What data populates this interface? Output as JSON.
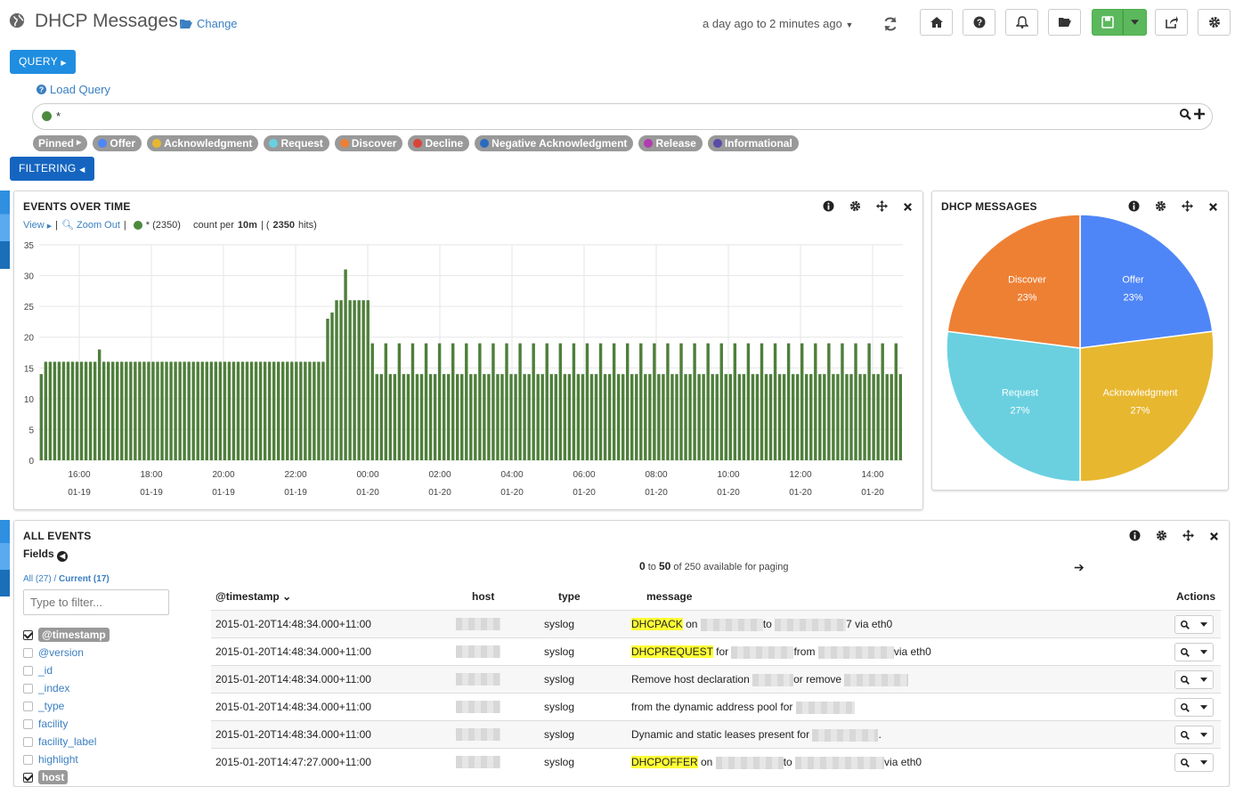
{
  "header": {
    "title": "DHCP Messages",
    "change_label": "Change",
    "time_range": "a day ago to 2 minutes ago"
  },
  "toolbar": {
    "icons": [
      "home-icon",
      "question-icon",
      "bell-icon",
      "folder-open-icon",
      "save-icon",
      "caret-down-icon",
      "share-icon",
      "gear-icon"
    ]
  },
  "query": {
    "query_btn": "QUERY",
    "load_query": "Load Query",
    "value": "*",
    "filter_btn": "FILTERING"
  },
  "pins": {
    "pinned": "Pinned",
    "items": [
      {
        "label": "Offer",
        "color": "#4f86f7"
      },
      {
        "label": "Acknowledgment",
        "color": "#e8b730"
      },
      {
        "label": "Request",
        "color": "#6ad0e0"
      },
      {
        "label": "Discover",
        "color": "#ee8034"
      },
      {
        "label": "Decline",
        "color": "#d9443a"
      },
      {
        "label": "Negative Acknowledgment",
        "color": "#2a6bbf"
      },
      {
        "label": "Release",
        "color": "#b23bb0"
      },
      {
        "label": "Informational",
        "color": "#5b4aa8"
      }
    ]
  },
  "events_panel": {
    "title": "EVENTS OVER TIME",
    "view": "View",
    "zoom_out": "Zoom Out",
    "series_label": "* (2350)",
    "count_per": "count per",
    "interval": "10m",
    "hits": "2350",
    "hits_suffix": "hits)"
  },
  "dhcp_panel": {
    "title": "DHCP MESSAGES"
  },
  "chart_data": [
    {
      "type": "bar",
      "title": "EVENTS OVER TIME",
      "ylim": [
        0,
        35
      ],
      "yticks": [
        0,
        5,
        10,
        15,
        20,
        25,
        30,
        35
      ],
      "xticks": [
        {
          "time": "16:00",
          "date": "01-19"
        },
        {
          "time": "18:00",
          "date": "01-19"
        },
        {
          "time": "20:00",
          "date": "01-19"
        },
        {
          "time": "22:00",
          "date": "01-19"
        },
        {
          "time": "00:00",
          "date": "01-20"
        },
        {
          "time": "02:00",
          "date": "01-20"
        },
        {
          "time": "04:00",
          "date": "01-20"
        },
        {
          "time": "06:00",
          "date": "01-20"
        },
        {
          "time": "08:00",
          "date": "01-20"
        },
        {
          "time": "10:00",
          "date": "01-20"
        },
        {
          "time": "12:00",
          "date": "01-20"
        },
        {
          "time": "14:00",
          "date": "01-20"
        }
      ],
      "values": [
        14,
        16,
        16,
        16,
        16,
        16,
        16,
        16,
        16,
        16,
        16,
        16,
        16,
        18,
        16,
        16,
        16,
        16,
        16,
        16,
        16,
        16,
        16,
        16,
        16,
        16,
        16,
        16,
        16,
        16,
        16,
        16,
        16,
        16,
        16,
        16,
        16,
        16,
        16,
        16,
        16,
        16,
        16,
        16,
        16,
        16,
        16,
        16,
        16,
        16,
        16,
        16,
        16,
        16,
        16,
        16,
        16,
        16,
        16,
        16,
        16,
        16,
        16,
        16,
        23,
        24,
        26,
        26,
        31,
        26,
        26,
        26,
        26,
        26,
        19,
        14,
        14,
        19,
        14,
        14,
        19,
        14,
        14,
        19,
        14,
        14,
        19,
        14,
        14,
        19,
        14,
        14,
        19,
        14,
        14,
        19,
        14,
        14,
        19,
        14,
        14,
        19,
        14,
        14,
        19,
        14,
        14,
        19,
        14,
        14,
        19,
        14,
        14,
        19,
        14,
        14,
        19,
        14,
        14,
        19,
        14,
        14,
        19,
        14,
        14,
        19,
        14,
        14,
        19,
        14,
        14,
        19,
        14,
        14,
        19,
        14,
        14,
        19,
        14,
        14,
        19,
        14,
        14,
        19,
        14,
        14,
        19,
        14,
        14,
        19,
        14,
        14,
        19,
        14,
        14,
        19,
        14,
        14,
        19,
        14,
        14,
        19,
        14,
        14,
        19,
        14,
        14,
        19,
        14,
        14,
        19,
        14,
        14,
        19,
        14,
        14,
        19,
        14,
        14,
        19,
        14,
        14,
        19,
        14,
        14,
        19,
        14,
        14,
        19,
        14,
        14,
        19,
        14
      ]
    },
    {
      "type": "pie",
      "title": "DHCP MESSAGES",
      "slices": [
        {
          "label": "Offer",
          "value": 23,
          "color": "#4f86f7"
        },
        {
          "label": "Acknowledgment",
          "value": 27,
          "color": "#e8b730"
        },
        {
          "label": "Request",
          "value": 27,
          "color": "#6ad0e0"
        },
        {
          "label": "Discover",
          "value": 23,
          "color": "#ee8034"
        }
      ]
    }
  ],
  "all_events": {
    "title": "ALL EVENTS",
    "fields_label": "Fields",
    "tab_all": "All (27)",
    "tab_current": "Current (17)",
    "filter_placeholder": "Type to filter...",
    "fields": [
      {
        "name": "@timestamp",
        "checked": true
      },
      {
        "name": "@version",
        "checked": false
      },
      {
        "name": "_id",
        "checked": false
      },
      {
        "name": "_index",
        "checked": false
      },
      {
        "name": "_type",
        "checked": false
      },
      {
        "name": "facility",
        "checked": false
      },
      {
        "name": "facility_label",
        "checked": false
      },
      {
        "name": "highlight",
        "checked": false
      },
      {
        "name": "host",
        "checked": true
      }
    ],
    "paging_from": "0",
    "paging_to": "50",
    "paging_suffix": "of 250 available for paging",
    "columns": [
      "@timestamp",
      "host",
      "type",
      "message",
      "Actions"
    ],
    "rows": [
      {
        "timestamp": "2015-01-20T14:48:34.000+11:00",
        "type": "syslog",
        "msg_hl": "DHCPACK",
        "msg": [
          " on ",
          "to ",
          "7 via eth0"
        ]
      },
      {
        "timestamp": "2015-01-20T14:48:34.000+11:00",
        "type": "syslog",
        "msg_hl": "DHCPREQUEST",
        "msg": [
          " for ",
          "from ",
          "via eth0"
        ]
      },
      {
        "timestamp": "2015-01-20T14:48:34.000+11:00",
        "type": "syslog",
        "msg_hl": "",
        "msg": [
          "Remove host declaration ",
          "or remove ",
          ""
        ]
      },
      {
        "timestamp": "2015-01-20T14:48:34.000+11:00",
        "type": "syslog",
        "msg_hl": "",
        "msg": [
          "from the dynamic address pool for ",
          "",
          ""
        ]
      },
      {
        "timestamp": "2015-01-20T14:48:34.000+11:00",
        "type": "syslog",
        "msg_hl": "",
        "msg": [
          "Dynamic and static leases present for ",
          ".",
          ""
        ]
      },
      {
        "timestamp": "2015-01-20T14:47:27.000+11:00",
        "type": "syslog",
        "msg_hl": "DHCPOFFER",
        "msg": [
          " on ",
          "to ",
          "via eth0"
        ]
      }
    ]
  }
}
